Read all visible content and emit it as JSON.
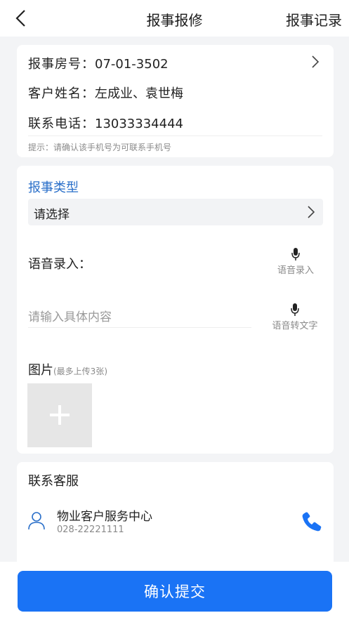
{
  "header": {
    "title": "报事报修",
    "right_link": "报事记录"
  },
  "report_info": {
    "room_label": "报事房号：",
    "room_value": "07-01-3502",
    "name_label": "客户姓名：",
    "name_value": "左成业、袁世梅",
    "phone_label": "联系电话：",
    "phone_value": "13033334444",
    "hint": "提示：请确认该手机号为可联系手机号"
  },
  "report_form": {
    "type_title": "报事类型",
    "type_select": "请选择",
    "voice_label": "语音录入：",
    "voice_button": "语音录入",
    "content_placeholder": "请输入具体内容",
    "voice_to_text_button": "语音转文字",
    "image_title": "图片",
    "image_limit": "(最多上传3张)"
  },
  "customer_service": {
    "title": "联系客服",
    "name": "物业客户服务中心",
    "phone": "028-22221111"
  },
  "footer": {
    "submit_label": "确认提交"
  },
  "colors": {
    "accent": "#1a73f5",
    "section_title": "#2a6fc9"
  },
  "icons": [
    "back-arrow-icon",
    "chevron-right-icon",
    "microphone-icon",
    "plus-icon",
    "user-icon",
    "phone-icon"
  ]
}
